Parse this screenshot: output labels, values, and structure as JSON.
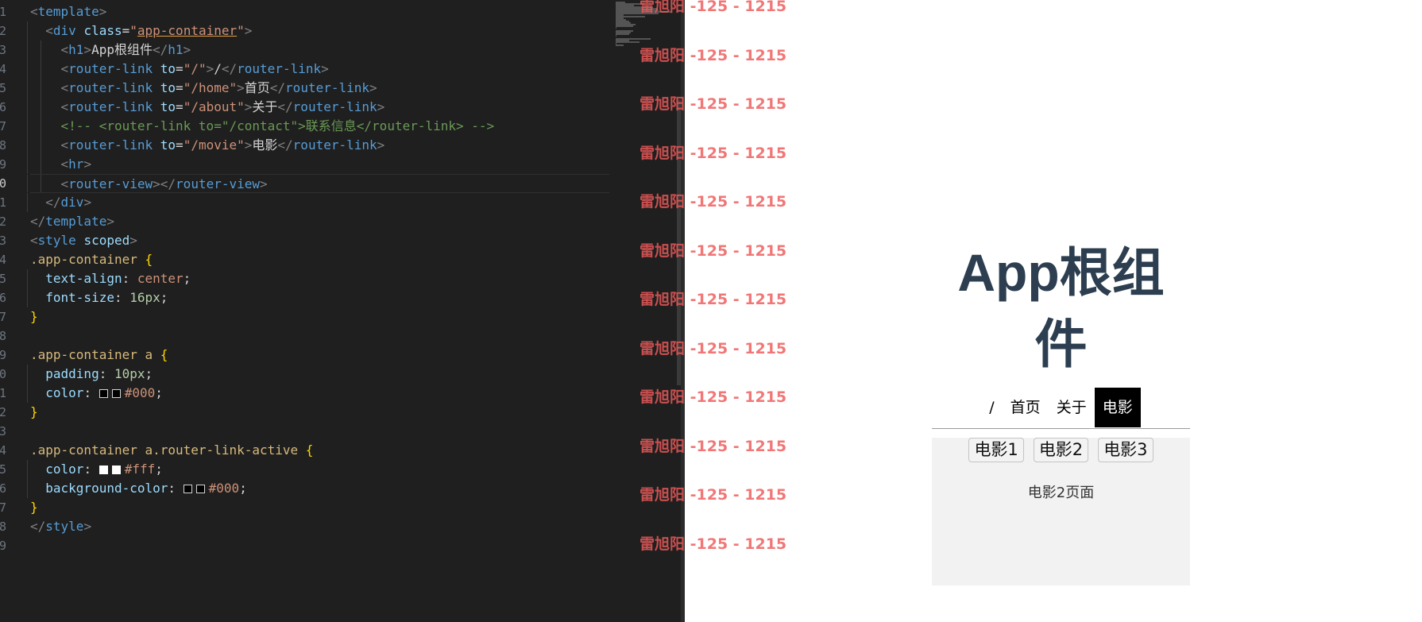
{
  "editor": {
    "line_numbers": [
      "1",
      "2",
      "3",
      "4",
      "5",
      "6",
      "7",
      "8",
      "9",
      "0",
      "1",
      "2",
      "3",
      "4",
      "5",
      "6",
      "7",
      "8",
      "9",
      "0",
      "1",
      "2",
      "3",
      "4",
      "5",
      "6",
      "7",
      "8",
      "9"
    ],
    "lines": [
      [
        {
          "t": "<",
          "c": "punct"
        },
        {
          "t": "template",
          "c": "tag"
        },
        {
          "t": ">",
          "c": "punct"
        }
      ],
      [
        {
          "t": "  "
        },
        {
          "t": "<",
          "c": "punct"
        },
        {
          "t": "div",
          "c": "tag"
        },
        {
          "t": " class",
          "c": "attr"
        },
        {
          "t": "=",
          "c": "text"
        },
        {
          "t": "\"",
          "c": "str"
        },
        {
          "t": "app-container",
          "c": "str-u"
        },
        {
          "t": "\"",
          "c": "str"
        },
        {
          "t": ">",
          "c": "punct"
        }
      ],
      [
        {
          "t": "    "
        },
        {
          "t": "<",
          "c": "punct"
        },
        {
          "t": "h1",
          "c": "tag"
        },
        {
          "t": ">",
          "c": "punct"
        },
        {
          "t": "App根组件",
          "c": "text"
        },
        {
          "t": "</",
          "c": "punct"
        },
        {
          "t": "h1",
          "c": "tag"
        },
        {
          "t": ">",
          "c": "punct"
        }
      ],
      [
        {
          "t": "    "
        },
        {
          "t": "<",
          "c": "punct"
        },
        {
          "t": "router-link",
          "c": "tag"
        },
        {
          "t": " to",
          "c": "attr"
        },
        {
          "t": "=",
          "c": "text"
        },
        {
          "t": "\"/\"",
          "c": "str"
        },
        {
          "t": ">",
          "c": "punct"
        },
        {
          "t": "/",
          "c": "text"
        },
        {
          "t": "</",
          "c": "punct"
        },
        {
          "t": "router-link",
          "c": "tag"
        },
        {
          "t": ">",
          "c": "punct"
        }
      ],
      [
        {
          "t": "    "
        },
        {
          "t": "<",
          "c": "punct"
        },
        {
          "t": "router-link",
          "c": "tag"
        },
        {
          "t": " to",
          "c": "attr"
        },
        {
          "t": "=",
          "c": "text"
        },
        {
          "t": "\"/home\"",
          "c": "str"
        },
        {
          "t": ">",
          "c": "punct"
        },
        {
          "t": "首页",
          "c": "text"
        },
        {
          "t": "</",
          "c": "punct"
        },
        {
          "t": "router-link",
          "c": "tag"
        },
        {
          "t": ">",
          "c": "punct"
        }
      ],
      [
        {
          "t": "    "
        },
        {
          "t": "<",
          "c": "punct"
        },
        {
          "t": "router-link",
          "c": "tag"
        },
        {
          "t": " to",
          "c": "attr"
        },
        {
          "t": "=",
          "c": "text"
        },
        {
          "t": "\"/about\"",
          "c": "str"
        },
        {
          "t": ">",
          "c": "punct"
        },
        {
          "t": "关于",
          "c": "text"
        },
        {
          "t": "</",
          "c": "punct"
        },
        {
          "t": "router-link",
          "c": "tag"
        },
        {
          "t": ">",
          "c": "punct"
        }
      ],
      [
        {
          "t": "    "
        },
        {
          "t": "<!-- <router-link to=\"/contact\">联系信息</router-link> -->",
          "c": "comment"
        }
      ],
      [
        {
          "t": "    "
        },
        {
          "t": "<",
          "c": "punct"
        },
        {
          "t": "router-link",
          "c": "tag"
        },
        {
          "t": " to",
          "c": "attr"
        },
        {
          "t": "=",
          "c": "text"
        },
        {
          "t": "\"/movie\"",
          "c": "str"
        },
        {
          "t": ">",
          "c": "punct"
        },
        {
          "t": "电影",
          "c": "text"
        },
        {
          "t": "</",
          "c": "punct"
        },
        {
          "t": "router-link",
          "c": "tag"
        },
        {
          "t": ">",
          "c": "punct"
        }
      ],
      [
        {
          "t": "    "
        },
        {
          "t": "<",
          "c": "punct"
        },
        {
          "t": "hr",
          "c": "tag"
        },
        {
          "t": ">",
          "c": "punct"
        }
      ],
      [
        {
          "t": "    "
        },
        {
          "t": "<",
          "c": "punct"
        },
        {
          "t": "router-view",
          "c": "tag"
        },
        {
          "t": "></",
          "c": "punct"
        },
        {
          "t": "router-view",
          "c": "tag"
        },
        {
          "t": ">",
          "c": "punct"
        }
      ],
      [
        {
          "t": "  "
        },
        {
          "t": "</",
          "c": "punct"
        },
        {
          "t": "div",
          "c": "tag"
        },
        {
          "t": ">",
          "c": "punct"
        }
      ],
      [
        {
          "t": "</",
          "c": "punct"
        },
        {
          "t": "template",
          "c": "tag"
        },
        {
          "t": ">",
          "c": "punct"
        }
      ],
      [
        {
          "t": "<",
          "c": "punct"
        },
        {
          "t": "style",
          "c": "tag"
        },
        {
          "t": " scoped",
          "c": "attr"
        },
        {
          "t": ">",
          "c": "punct"
        }
      ],
      [
        {
          "t": ".app-container",
          "c": "sel"
        },
        {
          "t": " "
        },
        {
          "t": "{",
          "c": "brace"
        }
      ],
      [
        {
          "t": "  "
        },
        {
          "t": "text-align",
          "c": "prop"
        },
        {
          "t": ": ",
          "c": "text"
        },
        {
          "t": "center",
          "c": "val"
        },
        {
          "t": ";",
          "c": "text"
        }
      ],
      [
        {
          "t": "  "
        },
        {
          "t": "font-size",
          "c": "prop"
        },
        {
          "t": ": ",
          "c": "text"
        },
        {
          "t": "16px",
          "c": "num"
        },
        {
          "t": ";",
          "c": "text"
        }
      ],
      [
        {
          "t": "}",
          "c": "brace"
        }
      ],
      [],
      [
        {
          "t": ".app-container a",
          "c": "sel"
        },
        {
          "t": " "
        },
        {
          "t": "{",
          "c": "brace"
        }
      ],
      [
        {
          "t": "  "
        },
        {
          "t": "padding",
          "c": "prop"
        },
        {
          "t": ": ",
          "c": "text"
        },
        {
          "t": "10px",
          "c": "num"
        },
        {
          "t": ";",
          "c": "text"
        }
      ],
      [
        {
          "t": "  "
        },
        {
          "t": "color",
          "c": "prop"
        },
        {
          "t": ": ",
          "c": "text"
        },
        {
          "t": "",
          "c": "swatch-black"
        },
        {
          "t": "",
          "c": "swatch-black"
        },
        {
          "t": "#000",
          "c": "val"
        },
        {
          "t": ";",
          "c": "text"
        }
      ],
      [
        {
          "t": "}",
          "c": "brace"
        }
      ],
      [],
      [
        {
          "t": ".app-container a.router-link-active",
          "c": "sel"
        },
        {
          "t": " "
        },
        {
          "t": "{",
          "c": "brace"
        }
      ],
      [
        {
          "t": "  "
        },
        {
          "t": "color",
          "c": "prop"
        },
        {
          "t": ": ",
          "c": "text"
        },
        {
          "t": "",
          "c": "swatch-white"
        },
        {
          "t": "",
          "c": "swatch-white"
        },
        {
          "t": "#fff",
          "c": "val"
        },
        {
          "t": ";",
          "c": "text"
        }
      ],
      [
        {
          "t": "  "
        },
        {
          "t": "background-color",
          "c": "prop"
        },
        {
          "t": ": ",
          "c": "text"
        },
        {
          "t": "",
          "c": "swatch-black"
        },
        {
          "t": "",
          "c": "swatch-black"
        },
        {
          "t": "#000",
          "c": "val"
        },
        {
          "t": ";",
          "c": "text"
        }
      ],
      [
        {
          "t": "}",
          "c": "brace"
        }
      ],
      [
        {
          "t": "</",
          "c": "punct"
        },
        {
          "t": "style",
          "c": "tag"
        },
        {
          "t": ">",
          "c": "punct"
        }
      ],
      []
    ],
    "current_line": 9
  },
  "app": {
    "title": "App根组件",
    "nav_links": [
      {
        "label": "/",
        "active": false
      },
      {
        "label": "首页",
        "active": false
      },
      {
        "label": "关于",
        "active": false
      },
      {
        "label": "电影",
        "active": true
      }
    ],
    "movie_links": [
      "电影1",
      "电影2",
      "电影3"
    ],
    "page_text": "电影2页面"
  },
  "watermark": {
    "text": "雷旭阳 -125 - 1215",
    "count": 12
  },
  "colors": {
    "editor_bg": "#1f1f1f",
    "title": "#2c3e50",
    "active_bg": "#000000",
    "active_fg": "#ffffff",
    "view_bg": "#f2f2f2",
    "watermark": "#ef5a5a"
  }
}
